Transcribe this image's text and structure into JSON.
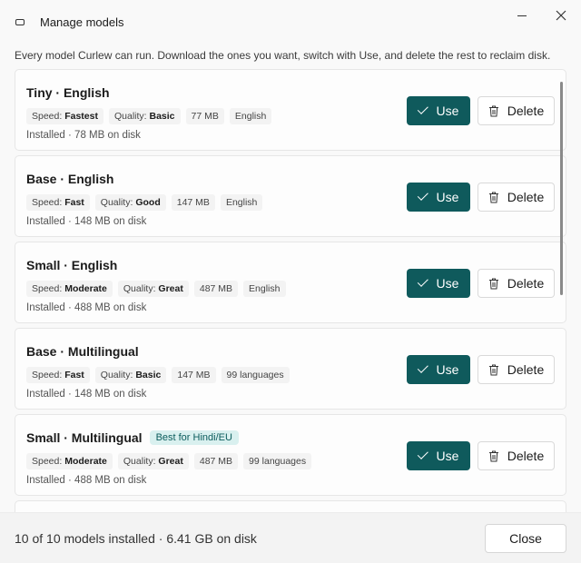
{
  "window": {
    "title": "Manage models",
    "icon": "app-icon"
  },
  "subtitle": "Every model Curlew can run. Download the ones you want, switch with Use, and delete the rest to reclaim disk.",
  "models": [
    {
      "name": "Tiny · English",
      "badge": "",
      "speed_label": "Speed:",
      "speed": "Fastest",
      "quality_label": "Quality:",
      "quality": "Basic",
      "size": "77 MB",
      "languages": "English",
      "status": "Installed · 78 MB on disk",
      "use_label": "Use",
      "delete_label": "Delete"
    },
    {
      "name": "Base · English",
      "badge": "",
      "speed_label": "Speed:",
      "speed": "Fast",
      "quality_label": "Quality:",
      "quality": "Good",
      "size": "147 MB",
      "languages": "English",
      "status": "Installed · 148 MB on disk",
      "use_label": "Use",
      "delete_label": "Delete"
    },
    {
      "name": "Small · English",
      "badge": "",
      "speed_label": "Speed:",
      "speed": "Moderate",
      "quality_label": "Quality:",
      "quality": "Great",
      "size": "487 MB",
      "languages": "English",
      "status": "Installed · 488 MB on disk",
      "use_label": "Use",
      "delete_label": "Delete"
    },
    {
      "name": "Base · Multilingual",
      "badge": "",
      "speed_label": "Speed:",
      "speed": "Fast",
      "quality_label": "Quality:",
      "quality": "Basic",
      "size": "147 MB",
      "languages": "99 languages",
      "status": "Installed · 148 MB on disk",
      "use_label": "Use",
      "delete_label": "Delete"
    },
    {
      "name": "Small · Multilingual",
      "badge": "Best for Hindi/EU",
      "speed_label": "Speed:",
      "speed": "Moderate",
      "quality_label": "Quality:",
      "quality": "Great",
      "size": "487 MB",
      "languages": "99 languages",
      "status": "Installed · 488 MB on disk",
      "use_label": "Use",
      "delete_label": "Delete"
    }
  ],
  "footer": {
    "summary": "10 of 10 models installed · 6.41 GB on disk",
    "close_label": "Close"
  },
  "colors": {
    "accent": "#0f5a5c",
    "badge_bg": "#d9f0ef",
    "badge_text": "#0b5c5c"
  }
}
